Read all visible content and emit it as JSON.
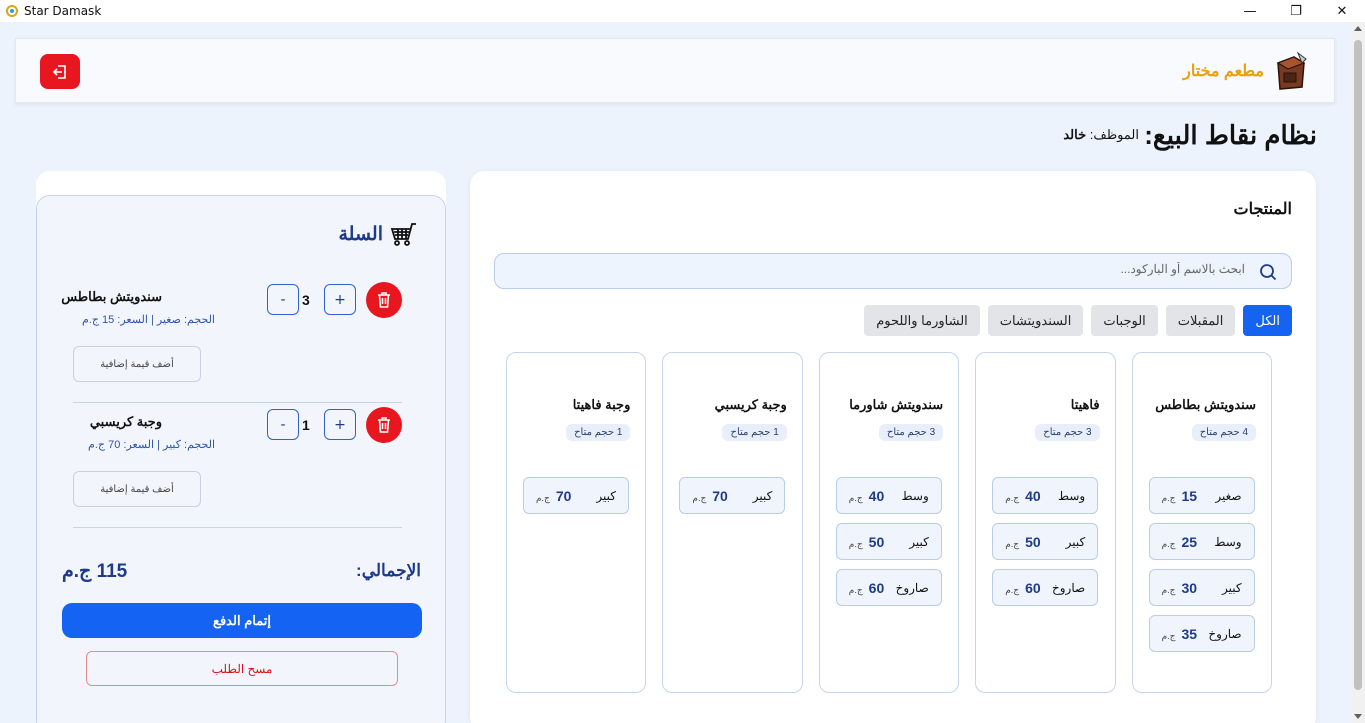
{
  "window": {
    "title": "Star Damask",
    "min": "—",
    "max": "❐",
    "close": "✕"
  },
  "header": {
    "restaurant_name": "مطعم مختار"
  },
  "page": {
    "title": "نظام نقاط البيع:",
    "employee_label": "الموظف:",
    "employee_name": "خالد"
  },
  "products": {
    "title": "المنتجات",
    "search_placeholder": "ابحث بالاسم أو الباركود...",
    "tabs": [
      {
        "label": "الكل",
        "active": true
      },
      {
        "label": "المقبلات",
        "active": false
      },
      {
        "label": "الوجبات",
        "active": false
      },
      {
        "label": "السندويتشات",
        "active": false
      },
      {
        "label": "الشاورما واللحوم",
        "active": false
      }
    ],
    "cards": [
      {
        "name": "سندويتش بطاطس",
        "badge": "4 حجم متاح",
        "sizes": [
          {
            "label": "صغير",
            "price": "15",
            "cur": "ج.م"
          },
          {
            "label": "وسط",
            "price": "25",
            "cur": "ج.م"
          },
          {
            "label": "كبير",
            "price": "30",
            "cur": "ج.م"
          },
          {
            "label": "صاروخ",
            "price": "35",
            "cur": "ج.م"
          }
        ]
      },
      {
        "name": "فاهيتا",
        "badge": "3 حجم متاح",
        "sizes": [
          {
            "label": "وسط",
            "price": "40",
            "cur": "ج.م"
          },
          {
            "label": "كبير",
            "price": "50",
            "cur": "ج.م"
          },
          {
            "label": "صاروخ",
            "price": "60",
            "cur": "ج.م"
          }
        ]
      },
      {
        "name": "سندويتش شاورما",
        "badge": "3 حجم متاح",
        "sizes": [
          {
            "label": "وسط",
            "price": "40",
            "cur": "ج.م"
          },
          {
            "label": "كبير",
            "price": "50",
            "cur": "ج.م"
          },
          {
            "label": "صاروخ",
            "price": "60",
            "cur": "ج.م"
          }
        ]
      },
      {
        "name": "وجبة كريسبي",
        "badge": "1 حجم متاح",
        "sizes": [
          {
            "label": "كبير",
            "price": "70",
            "cur": "ج.م"
          }
        ]
      },
      {
        "name": "وجبة فاهيتا",
        "badge": "1 حجم متاح",
        "sizes": [
          {
            "label": "كبير",
            "price": "70",
            "cur": "ج.م"
          }
        ]
      }
    ]
  },
  "cart": {
    "title": "السلة",
    "items": [
      {
        "name": "سندويتش بطاطس",
        "meta": "الحجم: صغير | السعر: 15 ج.م",
        "qty": "3",
        "extra_label": "أضف قيمة إضافية",
        "minus": "-",
        "plus": "+"
      },
      {
        "name": "وجبة كريسبي",
        "meta": "الحجم: كبير | السعر: 70 ج.م",
        "qty": "1",
        "extra_label": "أضف قيمة إضافية",
        "minus": "-",
        "plus": "+"
      }
    ],
    "total_label": "الإجمالي:",
    "total_value": "115 ج.م",
    "pay_label": "إتمام الدفع",
    "clear_label": "مسح الطلب"
  },
  "colors": {
    "accent": "#1463f3",
    "danger": "#e8171f",
    "brand": "#e9a00f",
    "navy": "#1e3a8a"
  }
}
